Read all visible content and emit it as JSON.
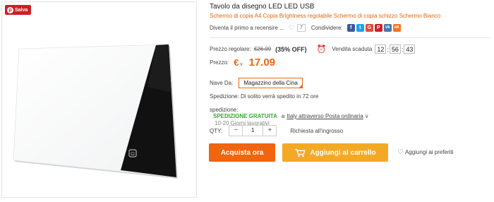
{
  "pin_button": {
    "label": "Salva",
    "icon": "pinterest-icon",
    "color": "#cb2027"
  },
  "product_image": {
    "alt": "light-pad-tablet-image",
    "logo_glyph": "⊡"
  },
  "product": {
    "title": "Tavolo da disegno LED LED USB",
    "subtitle": "Schermo di copia A4 Copia Brightness regolabile Schermo di copia schizzo Schermo Bianco"
  },
  "reviews": {
    "first_review_label": "Diventa il primo a recensire ...",
    "wishlist_count": "7",
    "share_label": "Condividere:"
  },
  "socials": [
    {
      "name": "facebook",
      "glyph": "f",
      "color": "#3b5998"
    },
    {
      "name": "twitter",
      "glyph": "t",
      "color": "#1da1f2"
    },
    {
      "name": "google-plus",
      "glyph": "G",
      "color": "#dd4b39"
    },
    {
      "name": "pinterest",
      "glyph": "P",
      "color": "#cb2027"
    },
    {
      "name": "vk",
      "glyph": "vk",
      "color": "#4a76a8"
    },
    {
      "name": "odnoklassniki",
      "glyph": "ok",
      "color": "#f4731c"
    }
  ],
  "pricing": {
    "regular_label": "Prezzo regolare:",
    "regular_price": "€26.09",
    "discount": "(35% OFF)",
    "expires_label": "Vendita scaduta",
    "timer": {
      "hours": "12",
      "minutes": "56",
      "seconds": "43"
    },
    "price_label": "Prezzo:",
    "currency": "€",
    "price": "17.09",
    "accent_color": "#f0650e"
  },
  "shipping": {
    "ship_from_label": "Nave Da:",
    "warehouse": "Magazzino della Cina",
    "ship_note": "Spedizione: Di solito verrà spedito in 72 ore",
    "shipping_label": "spedizione:",
    "free_shipping": "SPEDIZIONE GRATUITA",
    "to": "a",
    "via": "Italy attraverso Posta ordinaria",
    "days": "10-20 Giorni lavorativi"
  },
  "quantity": {
    "label": "QTY:",
    "minus": "−",
    "value": "1",
    "plus": "+",
    "bulk_label": "Richiesta all'ingrosso"
  },
  "actions": {
    "buy_now": "Acquista ora",
    "add_to_cart": "Aggiungi al carrello",
    "add_to_wishlist": "Aggiungi ai preferiti",
    "buy_color": "#f0650e",
    "cart_color": "#f4a925"
  }
}
